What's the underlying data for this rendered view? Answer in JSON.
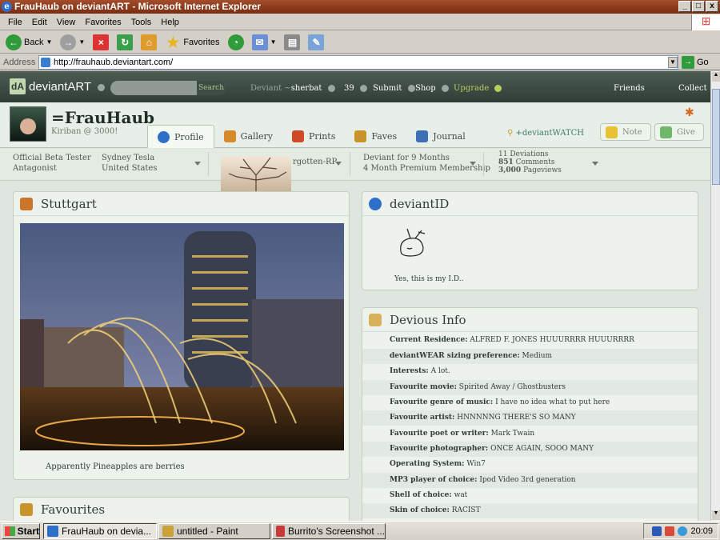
{
  "window": {
    "title": "FrauHaub on deviantART - Microsoft Internet Explorer"
  },
  "menu": [
    "File",
    "Edit",
    "View",
    "Favorites",
    "Tools",
    "Help"
  ],
  "toolbar": {
    "back": "Back",
    "favorites": "Favorites"
  },
  "address": {
    "label": "Address",
    "url": "http://frauhaub.deviantart.com/",
    "go": "Go"
  },
  "da_nav": {
    "logo": "deviantART",
    "search_button": "Search",
    "deviant_label": "Deviant",
    "deviant_name": "sherbat",
    "message_count": "39",
    "submit": "Submit",
    "shop": "Shop",
    "upgrade": "Upgrade",
    "friends": "Friends",
    "collect": "Collect"
  },
  "profile": {
    "username": "=FrauHaub",
    "tagline": "Kiriban @ 3000!",
    "tabs": [
      "Profile",
      "Gallery",
      "Prints",
      "Faves",
      "Journal"
    ],
    "watch": "+deviantWATCH",
    "note": "Note",
    "give": "Give"
  },
  "infobar": {
    "title_line1": "Official Beta Tester",
    "title_line2": "Antagonist",
    "name": "Sydney Tesla",
    "country": "United States",
    "group": "rgotten-RP",
    "membership_line1": "Deviant for 9 Months",
    "membership_line2": "4 Month Premium Membership",
    "deviations": "11",
    "deviations_label": "Deviations",
    "comments": "851",
    "comments_label": "Comments",
    "pageviews": "3,000",
    "pageviews_label": "Pageviews"
  },
  "featured": {
    "title": "Stuttgart",
    "caption": "Apparently Pineapples are berries"
  },
  "favourites": {
    "title": "Favourites"
  },
  "deviantid": {
    "title": "deviantID",
    "caption": "Yes, this is my I.D.."
  },
  "devious": {
    "title": "Devious Info",
    "rows": [
      {
        "label": "Current Residence:",
        "value": "ALFRED F. JONES HUUURRRR HUUURRRR"
      },
      {
        "label": "deviantWEAR sizing preference:",
        "value": "Medium"
      },
      {
        "label": "Interests:",
        "value": "A lot."
      },
      {
        "label": "Favourite movie:",
        "value": "Spirited Away / Ghostbusters"
      },
      {
        "label": "Favourite genre of music:",
        "value": "I have no idea what to put here"
      },
      {
        "label": "Favourite artist:",
        "value": "HNNNNNG THERE'S SO MANY"
      },
      {
        "label": "Favourite poet or writer:",
        "value": "Mark Twain"
      },
      {
        "label": "Favourite photographer:",
        "value": "ONCE AGAIN, SOOO MANY"
      },
      {
        "label": "Operating System:",
        "value": "Win7"
      },
      {
        "label": "MP3 player of choice:",
        "value": "Ipod Video 3rd generation"
      },
      {
        "label": "Shell of choice:",
        "value": "wat"
      },
      {
        "label": "Skin of choice:",
        "value": "RACIST"
      }
    ]
  },
  "taskbar": {
    "start": "Start",
    "tasks": [
      "FrauHaub on devia...",
      "untitled - Paint",
      "Burrito's Screenshot ..."
    ],
    "clock": "20:09"
  }
}
